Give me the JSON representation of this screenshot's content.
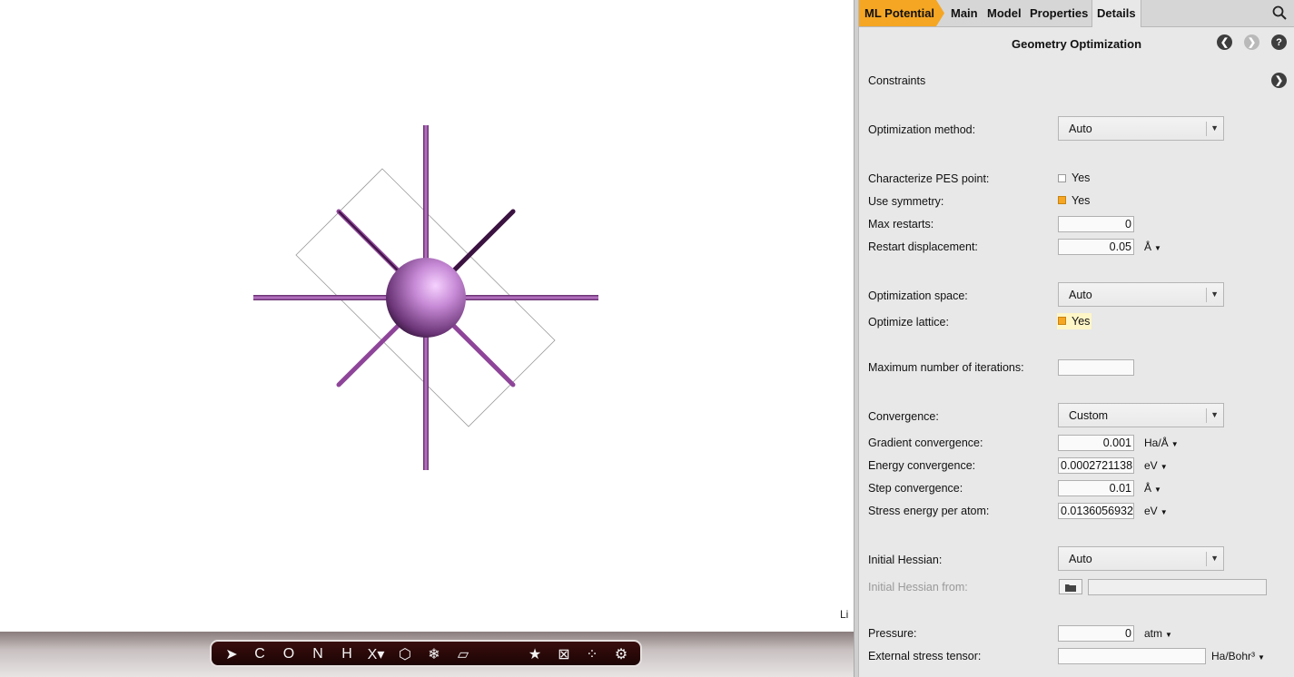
{
  "viewer": {
    "atom_label": "Li",
    "toolbar": [
      {
        "icon": "select-arrow-icon",
        "glyph": "➤"
      },
      {
        "icon": "carbon-icon",
        "glyph": "C"
      },
      {
        "icon": "oxygen-icon",
        "glyph": "O"
      },
      {
        "icon": "nitrogen-icon",
        "glyph": "N"
      },
      {
        "icon": "hydrogen-icon",
        "glyph": "H"
      },
      {
        "icon": "element-picker-icon",
        "glyph": "X▾"
      },
      {
        "icon": "ring-icon",
        "glyph": "⬡"
      },
      {
        "icon": "freeze-icon",
        "glyph": "❄"
      },
      {
        "icon": "slab-icon",
        "glyph": "▱"
      },
      {
        "icon": "favorite-icon",
        "glyph": "★"
      },
      {
        "icon": "cell-icon",
        "glyph": "⊠"
      },
      {
        "icon": "molecule-icon",
        "glyph": "⁘"
      },
      {
        "icon": "settings-gear-icon",
        "glyph": "⚙"
      }
    ]
  },
  "tabs": {
    "ml": "ML Potential",
    "main": "Main",
    "model": "Model",
    "properties": "Properties",
    "details": "Details"
  },
  "panel": {
    "title": "Geometry Optimization",
    "constraints": "Constraints",
    "optimization_method": {
      "label": "Optimization method:",
      "value": "Auto"
    },
    "characterize_pes": {
      "label": "Characterize PES point:",
      "option": "Yes",
      "checked": false
    },
    "use_symmetry": {
      "label": "Use symmetry:",
      "option": "Yes",
      "checked": true
    },
    "max_restarts": {
      "label": "Max restarts:",
      "value": "0"
    },
    "restart_displacement": {
      "label": "Restart displacement:",
      "value": "0.05",
      "unit": "Å"
    },
    "optimization_space": {
      "label": "Optimization space:",
      "value": "Auto"
    },
    "optimize_lattice": {
      "label": "Optimize lattice:",
      "option": "Yes",
      "checked": true
    },
    "max_iterations": {
      "label": "Maximum number of iterations:",
      "value": ""
    },
    "convergence": {
      "label": "Convergence:",
      "value": "Custom"
    },
    "gradient_convergence": {
      "label": "Gradient convergence:",
      "value": "0.001",
      "unit": "Ha/Å"
    },
    "energy_convergence": {
      "label": "Energy convergence:",
      "value": "0.0002721138",
      "unit": "eV"
    },
    "step_convergence": {
      "label": "Step convergence:",
      "value": "0.01",
      "unit": "Å"
    },
    "stress_energy": {
      "label": "Stress energy per atom:",
      "value": "0.0136056932",
      "unit": "eV"
    },
    "initial_hessian": {
      "label": "Initial Hessian:",
      "value": "Auto"
    },
    "initial_hessian_from": {
      "label": "Initial Hessian from:",
      "value": ""
    },
    "pressure": {
      "label": "Pressure:",
      "value": "0",
      "unit": "atm"
    },
    "external_stress": {
      "label": "External stress tensor:",
      "value": "",
      "unit": "Ha/Bohr³"
    }
  },
  "colors": {
    "accent": "#f5a623",
    "atom": "#c97fd6",
    "bond": "#9c4aa8"
  }
}
